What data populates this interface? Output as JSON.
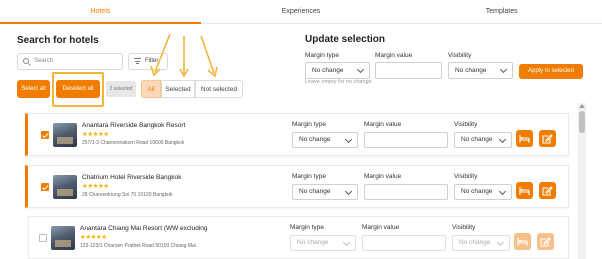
{
  "tabs": [
    {
      "label": "Hotels",
      "active": true
    },
    {
      "label": "Experiences",
      "active": false
    },
    {
      "label": "Templates",
      "active": false
    }
  ],
  "search_panel": {
    "title": "Search for hotels",
    "search_placeholder": "Search",
    "filter_label": "Filter",
    "select_all_label": "Select all",
    "deselect_all_label": "Deselect all",
    "selected_count": "2 selected",
    "segments": [
      {
        "label": "All",
        "active": true
      },
      {
        "label": "Selected",
        "active": false
      },
      {
        "label": "Not selected",
        "active": false
      }
    ]
  },
  "update_panel": {
    "title": "Update selection",
    "margin_type_label": "Margin type",
    "margin_type_value": "No change",
    "margin_value_label": "Margin value",
    "visibility_label": "Visibility",
    "visibility_value": "No change",
    "hint": "Leave empty for no change",
    "apply_label": "Apply to selected"
  },
  "colors": {
    "accent": "#f07d00",
    "highlight": "#f4b43c",
    "star": "#f5b400"
  },
  "hotels": [
    {
      "name": "Anantara Riverside Bangkok Resort",
      "stars": "★★★★★",
      "address": "257/1-3 Charoennakorn Road 10600 Bangkok",
      "selected": true,
      "margin_type_label": "Margin type",
      "margin_type": "No change",
      "margin_value_label": "Margin value",
      "visibility_label": "Visibility",
      "visibility": "No change"
    },
    {
      "name": "Chatrium Hotel Riverside Bangkok",
      "stars": "★★★★★",
      "address": "28 Charoenkrung Soi 70 10120 Bangkok",
      "selected": true,
      "margin_type_label": "Margin type",
      "margin_type": "No change",
      "margin_value_label": "Margin value",
      "visibility_label": "Visibility",
      "visibility": "No change"
    },
    {
      "name": "Anantara Chiang Mai Resort (WW excluding",
      "stars": "★★★★★",
      "address": "123-123/1 Charoen Prathet Road 50100 Chiang Mai",
      "selected": false,
      "margin_type_label": "Margin type",
      "margin_type": "No change",
      "margin_value_label": "Margin value",
      "visibility_label": "Visibility",
      "visibility": "No change"
    }
  ]
}
